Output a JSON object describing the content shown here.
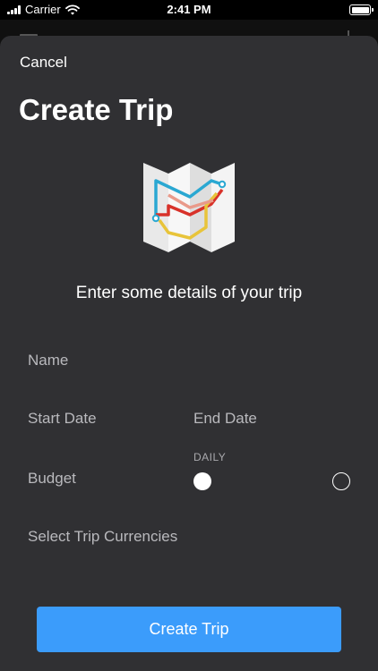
{
  "status_bar": {
    "carrier": "Carrier",
    "time": "2:41 PM"
  },
  "sheet": {
    "cancel_label": "Cancel",
    "title": "Create Trip",
    "subtitle": "Enter some details of your trip",
    "fields": {
      "name_placeholder": "Name",
      "start_date_placeholder": "Start Date",
      "end_date_placeholder": "End Date",
      "budget_placeholder": "Budget",
      "currencies_placeholder": "Select Trip Currencies"
    },
    "budget_period": {
      "label": "DAILY",
      "daily_selected": true
    },
    "create_button_label": "Create Trip"
  },
  "colors": {
    "sheet_background": "#303033",
    "accent": "#3b9cfb",
    "placeholder_text": "#b9b9bd",
    "map_route_blue": "#2aa8d2",
    "map_route_red": "#d8322a",
    "map_route_yellow": "#e8c43a",
    "map_route_salmon": "#e99a8a"
  },
  "icons": {
    "signal": "cellular-signal-icon",
    "wifi": "wifi-icon",
    "battery": "battery-icon",
    "illustration": "folded-map-routes-icon"
  }
}
